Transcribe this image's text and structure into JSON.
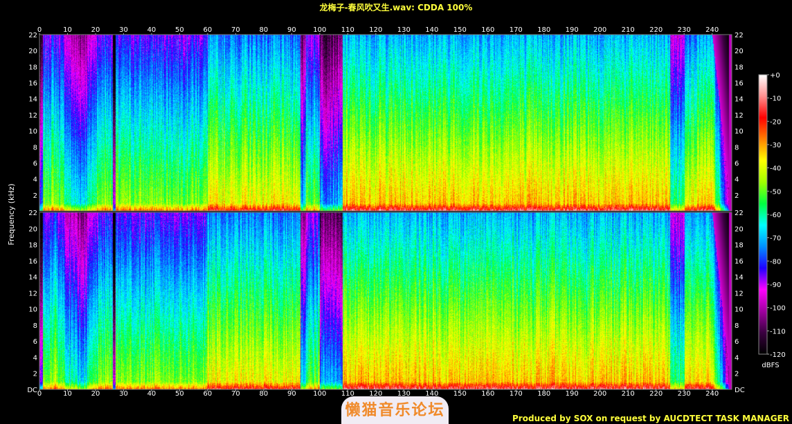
{
  "title": "龙梅子-春风吹又生.wav: CDDA 100%",
  "footer": "Produced by SOX on request by AUCDTECT TASK MANAGER",
  "watermark": "懒猫音乐论坛",
  "chart_data": {
    "type": "heatmap",
    "title": "龙梅子-春风吹又生.wav: CDDA 100%",
    "xlabel": "",
    "ylabel": "Frequency (kHz)",
    "x_ticks": [
      0,
      10,
      20,
      30,
      40,
      50,
      60,
      70,
      80,
      90,
      100,
      110,
      120,
      130,
      140,
      150,
      160,
      170,
      180,
      190,
      200,
      210,
      220,
      230,
      240
    ],
    "xlim": [
      0,
      247
    ],
    "channels": 2,
    "y_ticks": [
      "DC",
      "2",
      "4",
      "6",
      "8",
      "10",
      "12",
      "14",
      "16",
      "18",
      "20",
      "22"
    ],
    "y_tick_values": [
      0,
      2,
      4,
      6,
      8,
      10,
      12,
      14,
      16,
      18,
      20,
      22
    ],
    "ylim": [
      0,
      22
    ],
    "colorbar": {
      "label": "dBFS",
      "ticks": [
        "+0",
        "-10",
        "-20",
        "-30",
        "-40",
        "-50",
        "-60",
        "-70",
        "-80",
        "-90",
        "-100",
        "-110",
        "-120"
      ],
      "range": [
        -120,
        0
      ]
    },
    "palette": [
      "#000000",
      "#3a0040",
      "#a000a0",
      "#ff00ff",
      "#2000ff",
      "#0090ff",
      "#00ffff",
      "#00ff40",
      "#a0ff00",
      "#ffff00",
      "#ff8000",
      "#ff0000",
      "#ff9090",
      "#ffffff"
    ]
  }
}
